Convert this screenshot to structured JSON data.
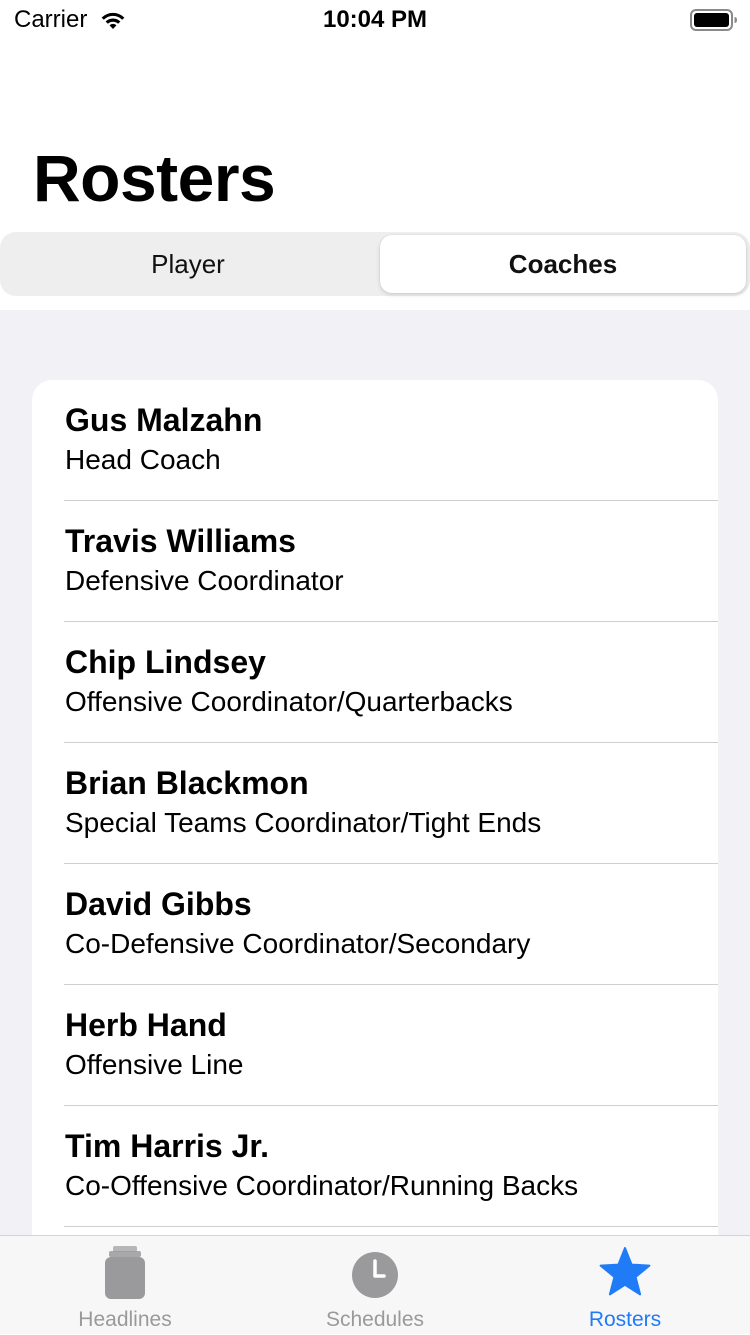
{
  "status_bar": {
    "carrier": "Carrier",
    "time": "10:04 PM"
  },
  "title": "Rosters",
  "segments": [
    {
      "label": "Player",
      "selected": false
    },
    {
      "label": "Coaches",
      "selected": true
    }
  ],
  "coaches": [
    {
      "name": "Gus Malzahn",
      "role": "Head Coach"
    },
    {
      "name": "Travis Williams",
      "role": "Defensive Coordinator"
    },
    {
      "name": "Chip Lindsey",
      "role": "Offensive Coordinator/Quarterbacks"
    },
    {
      "name": "Brian Blackmon",
      "role": "Special Teams Coordinator/Tight Ends"
    },
    {
      "name": "David Gibbs",
      "role": "Co-Defensive Coordinator/Secondary"
    },
    {
      "name": "Herb Hand",
      "role": "Offensive Line"
    },
    {
      "name": "Tim Harris Jr.",
      "role": "Co-Offensive Coordinator/Running Backs"
    }
  ],
  "tabs": [
    {
      "label": "Headlines",
      "icon": "stack-icon",
      "active": false
    },
    {
      "label": "Schedules",
      "icon": "clock-icon",
      "active": false
    },
    {
      "label": "Rosters",
      "icon": "star-icon",
      "active": true
    }
  ],
  "colors": {
    "accent": "#1f7cf6",
    "tab_inactive": "#9a9a9c",
    "list_background": "#f1f1f6"
  }
}
